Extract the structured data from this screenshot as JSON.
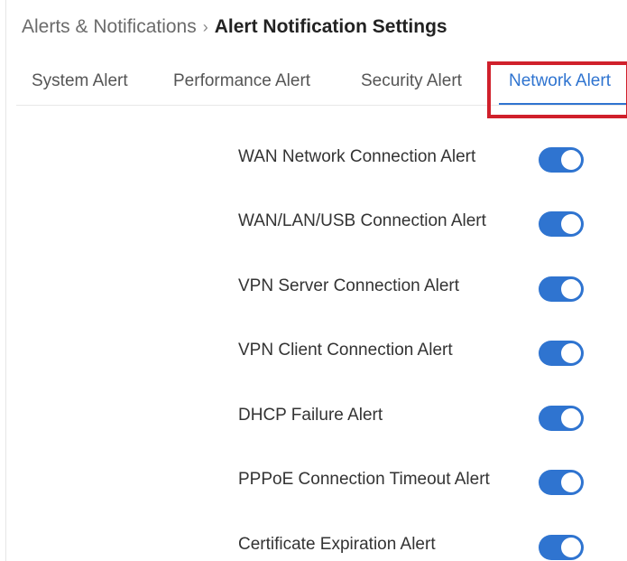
{
  "breadcrumb": {
    "parent": "Alerts & Notifications",
    "separator": "›",
    "current": "Alert Notification Settings"
  },
  "tabs": [
    {
      "label": "System Alert",
      "active": false
    },
    {
      "label": "Performance Alert",
      "active": false
    },
    {
      "label": "Security Alert",
      "active": false
    },
    {
      "label": "Network Alert",
      "active": true
    }
  ],
  "settings": [
    {
      "label": "WAN Network Connection Alert",
      "enabled": true
    },
    {
      "label": "WAN/LAN/USB Connection Alert",
      "enabled": true
    },
    {
      "label": "VPN Server Connection Alert",
      "enabled": true
    },
    {
      "label": "VPN Client Connection Alert",
      "enabled": true
    },
    {
      "label": "DHCP Failure Alert",
      "enabled": true
    },
    {
      "label": "PPPoE Connection Timeout Alert",
      "enabled": true
    },
    {
      "label": "Certificate Expiration Alert",
      "enabled": true
    }
  ],
  "colors": {
    "accent": "#2f74d0",
    "highlight": "#d0202b"
  }
}
